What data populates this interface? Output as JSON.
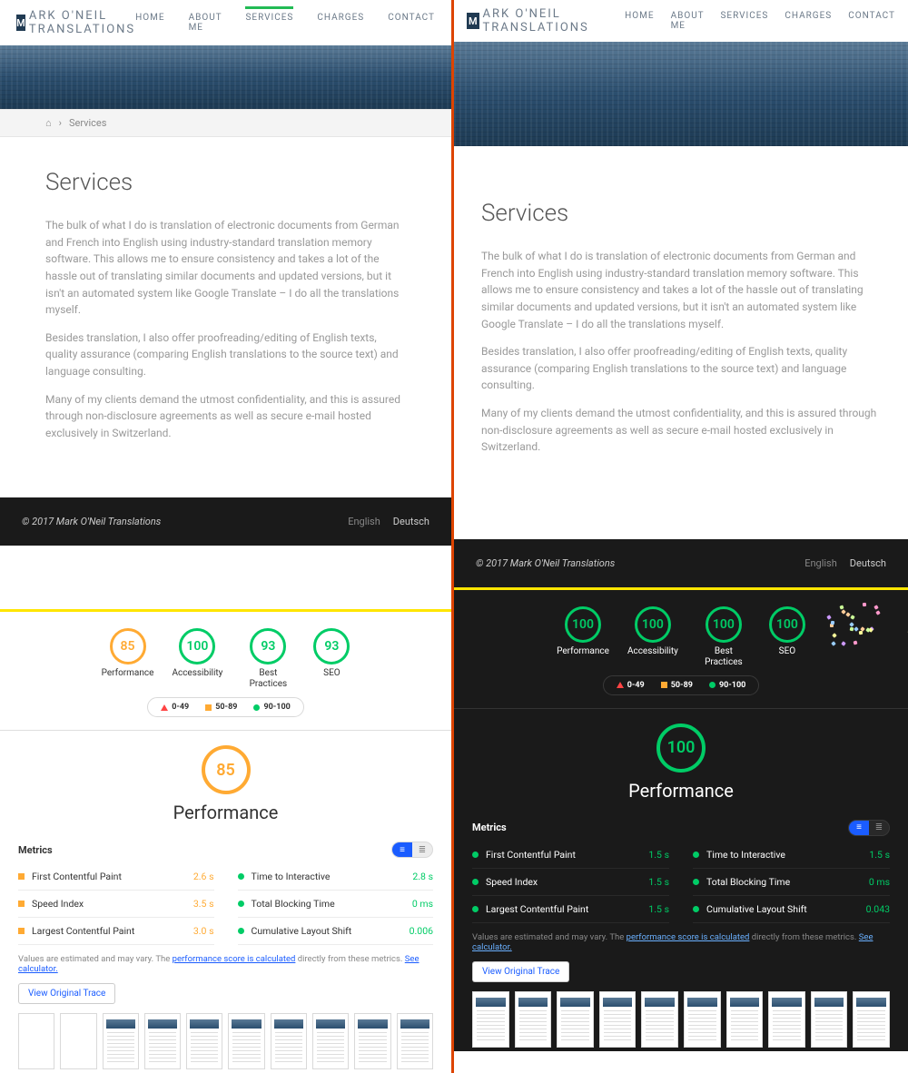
{
  "site": {
    "logo_letter": "M",
    "logo_text": "ARK O'NEIL TRANSLATIONS",
    "nav": [
      "HOME",
      "ABOUT ME",
      "SERVICES",
      "CHARGES",
      "CONTACT"
    ]
  },
  "breadcrumb": {
    "current": "Services"
  },
  "page": {
    "title": "Services",
    "p1": "The bulk of what I do is translation of electronic documents from German and French into English using industry-standard translation memory software. This allows me to ensure consistency and takes a lot of the hassle out of translating similar documents and updated versions, but it isn't an automated system like Google Translate – I do all the translations myself.",
    "p2": "Besides translation, I also offer proofreading/editing of English texts, quality assurance (comparing English translations to the source text) and language consulting.",
    "p3": "Many of my clients demand the utmost confidentiality, and this is assured through non-disclosure agreements as well as secure e-mail hosted exclusively in Switzerland."
  },
  "footer": {
    "copyright": "© 2017 Mark O'Neil Translations",
    "lang_en": "English",
    "lang_de": "Deutsch"
  },
  "legend": {
    "r1": "0-49",
    "r2": "50-89",
    "r3": "90-100"
  },
  "lighthouse": {
    "categories": [
      "Performance",
      "Accessibility",
      "Best Practices",
      "SEO"
    ],
    "disclaimer_pre": "Values are estimated and may vary. The ",
    "disclaimer_link1": "performance score is calculated",
    "disclaimer_mid": " directly from these metrics. ",
    "disclaimer_link2": "See calculator.",
    "trace_btn": "View Original Trace",
    "metrics_label": "Metrics",
    "perf_heading": "Performance"
  },
  "left": {
    "scores": {
      "performance": "85",
      "accessibility": "100",
      "best_practices": "93",
      "seo": "93"
    },
    "big_score": "85",
    "metrics": [
      {
        "name": "First Contentful Paint",
        "value": "2.6 s",
        "status": "o"
      },
      {
        "name": "Time to Interactive",
        "value": "2.8 s",
        "status": "g"
      },
      {
        "name": "Speed Index",
        "value": "3.5 s",
        "status": "o"
      },
      {
        "name": "Total Blocking Time",
        "value": "0 ms",
        "status": "g"
      },
      {
        "name": "Largest Contentful Paint",
        "value": "3.0 s",
        "status": "o"
      },
      {
        "name": "Cumulative Layout Shift",
        "value": "0.006",
        "status": "g"
      }
    ]
  },
  "rightp": {
    "scores": {
      "performance": "100",
      "accessibility": "100",
      "best_practices": "100",
      "seo": "100"
    },
    "big_score": "100",
    "metrics": [
      {
        "name": "First Contentful Paint",
        "value": "1.5 s",
        "status": "g"
      },
      {
        "name": "Time to Interactive",
        "value": "1.5 s",
        "status": "g"
      },
      {
        "name": "Speed Index",
        "value": "1.5 s",
        "status": "g"
      },
      {
        "name": "Total Blocking Time",
        "value": "0 ms",
        "status": "g"
      },
      {
        "name": "Largest Contentful Paint",
        "value": "1.5 s",
        "status": "g"
      },
      {
        "name": "Cumulative Layout Shift",
        "value": "0.043",
        "status": "g"
      }
    ]
  }
}
